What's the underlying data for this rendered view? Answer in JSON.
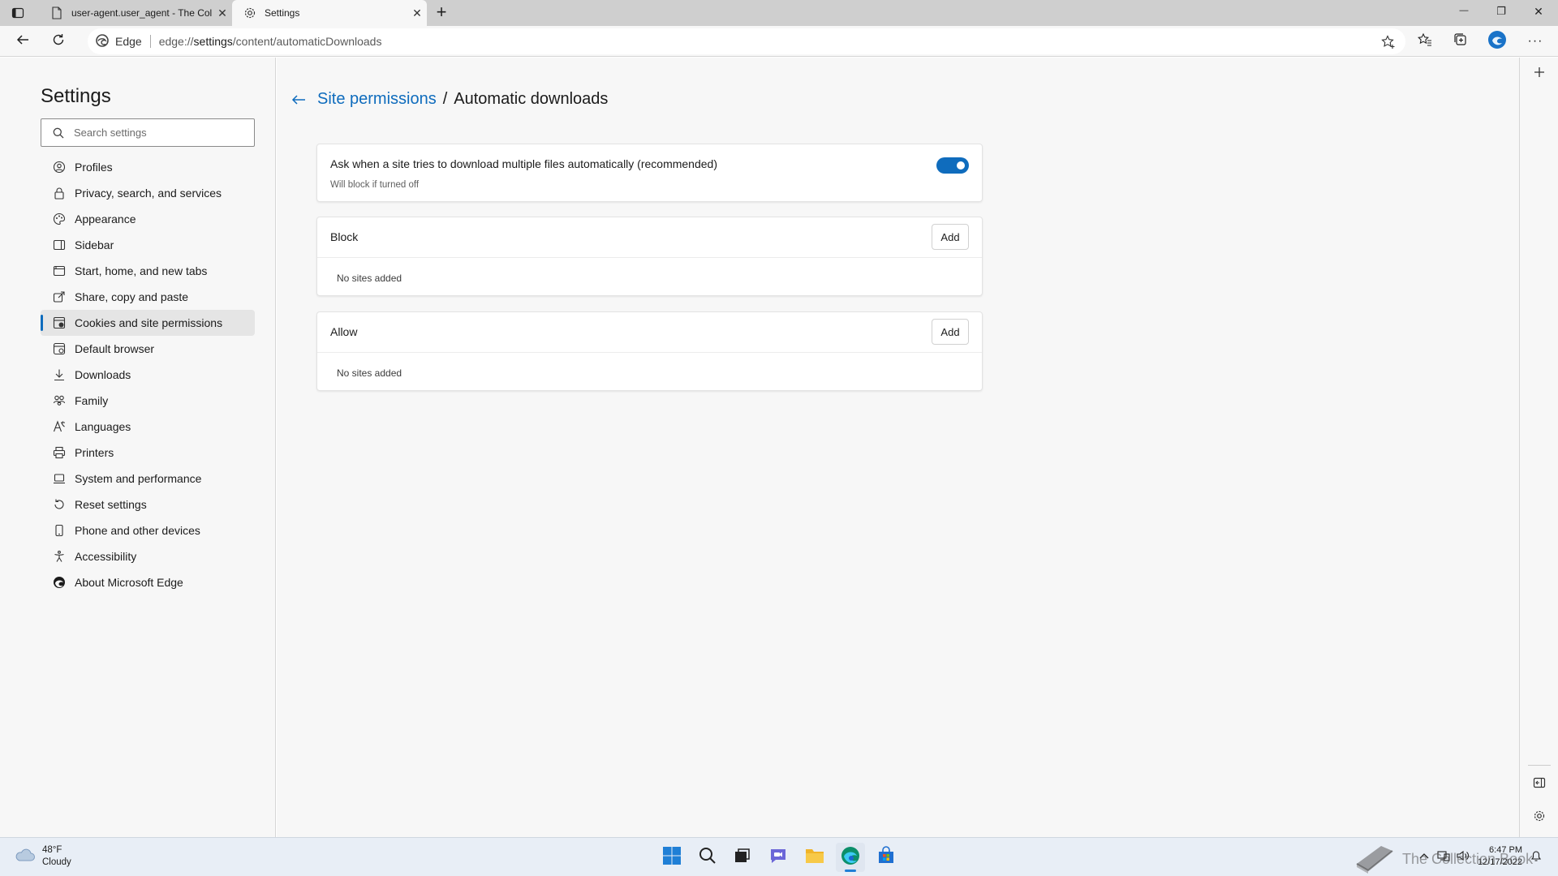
{
  "tabs": [
    {
      "title": "user-agent.user_agent - The Coll",
      "close": "✕"
    },
    {
      "title": "Settings",
      "close": "✕"
    }
  ],
  "new_tab": "+",
  "window_controls": {
    "minimize": "—",
    "restore": "❐",
    "close": "✕"
  },
  "address": {
    "identity": "Edge",
    "url_prefix": "edge://",
    "url_host": "settings",
    "url_path": "/content/automaticDownloads"
  },
  "sidebar": {
    "title": "Settings",
    "search_placeholder": "Search settings",
    "items": [
      {
        "label": "Profiles",
        "icon": "profile-icon"
      },
      {
        "label": "Privacy, search, and services",
        "icon": "lock-icon"
      },
      {
        "label": "Appearance",
        "icon": "appearance-icon"
      },
      {
        "label": "Sidebar",
        "icon": "sidebar-icon"
      },
      {
        "label": "Start, home, and new tabs",
        "icon": "home-icon"
      },
      {
        "label": "Share, copy and paste",
        "icon": "share-icon"
      },
      {
        "label": "Cookies and site permissions",
        "icon": "cookies-icon",
        "active": true
      },
      {
        "label": "Default browser",
        "icon": "browser-icon"
      },
      {
        "label": "Downloads",
        "icon": "download-icon"
      },
      {
        "label": "Family",
        "icon": "family-icon"
      },
      {
        "label": "Languages",
        "icon": "languages-icon"
      },
      {
        "label": "Printers",
        "icon": "printer-icon"
      },
      {
        "label": "System and performance",
        "icon": "laptop-icon"
      },
      {
        "label": "Reset settings",
        "icon": "reset-icon"
      },
      {
        "label": "Phone and other devices",
        "icon": "phone-icon"
      },
      {
        "label": "Accessibility",
        "icon": "accessibility-icon"
      },
      {
        "label": "About Microsoft Edge",
        "icon": "edge-logo-icon"
      }
    ]
  },
  "main": {
    "breadcrumb_parent": "Site permissions",
    "breadcrumb_sep": "/",
    "breadcrumb_current": "Automatic downloads",
    "ask_setting": {
      "title": "Ask when a site tries to download multiple files automatically (recommended)",
      "subtitle": "Will block if turned off",
      "enabled": true
    },
    "block": {
      "title": "Block",
      "add_label": "Add",
      "empty_text": "No sites added"
    },
    "allow": {
      "title": "Allow",
      "add_label": "Add",
      "empty_text": "No sites added"
    }
  },
  "taskbar": {
    "weather_temp": "48°F",
    "weather_desc": "Cloudy",
    "time": "6:47 PM",
    "date": "12/17/2022"
  },
  "watermark": "The Collection Book",
  "colors": {
    "accent": "#0f6cbd",
    "tab_strip": "#cfcfcf",
    "surface": "#f7f7f7"
  }
}
